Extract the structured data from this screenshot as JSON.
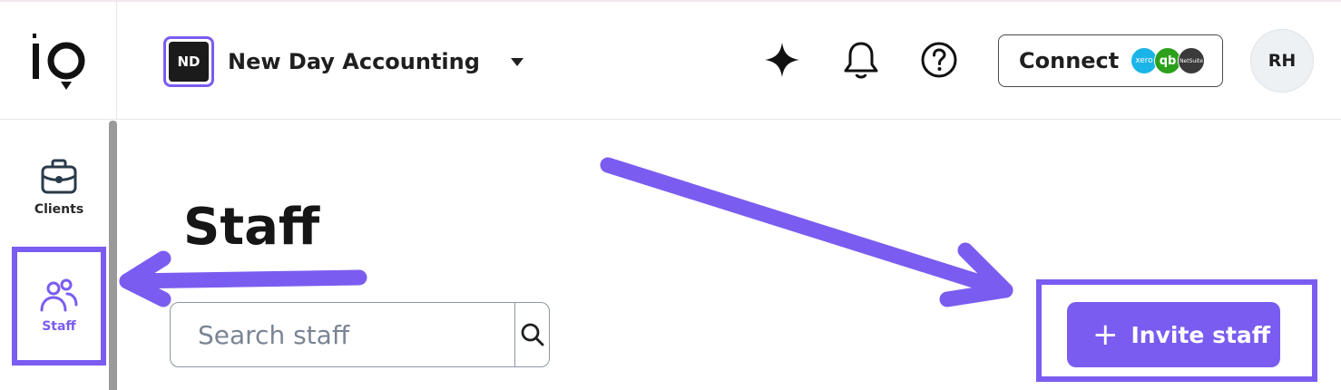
{
  "app": {
    "logo_text": "io"
  },
  "header": {
    "org_initials": "ND",
    "org_name": "New Day Accounting",
    "connect_label": "Connect",
    "connect_logos": [
      {
        "name": "xero",
        "label": "xero",
        "color": "#1ab4e8"
      },
      {
        "name": "quickbooks",
        "label": "qb",
        "color": "#2ca01c"
      },
      {
        "name": "netsuite",
        "label": "NetSuite",
        "color": "#3a3a3a"
      }
    ],
    "avatar_initials": "RH",
    "icons": [
      "sparkle-icon",
      "bell-icon",
      "help-icon"
    ]
  },
  "sidebar": {
    "items": [
      {
        "label": "Clients",
        "icon": "briefcase-icon",
        "active": false
      },
      {
        "label": "Staff",
        "icon": "people-icon",
        "active": true
      }
    ]
  },
  "main": {
    "title": "Staff",
    "search_placeholder": "Search staff",
    "invite_label": "Invite staff"
  },
  "colors": {
    "accent": "#7b5cf0",
    "text": "#1f1f1f",
    "border": "#8f97a3"
  }
}
